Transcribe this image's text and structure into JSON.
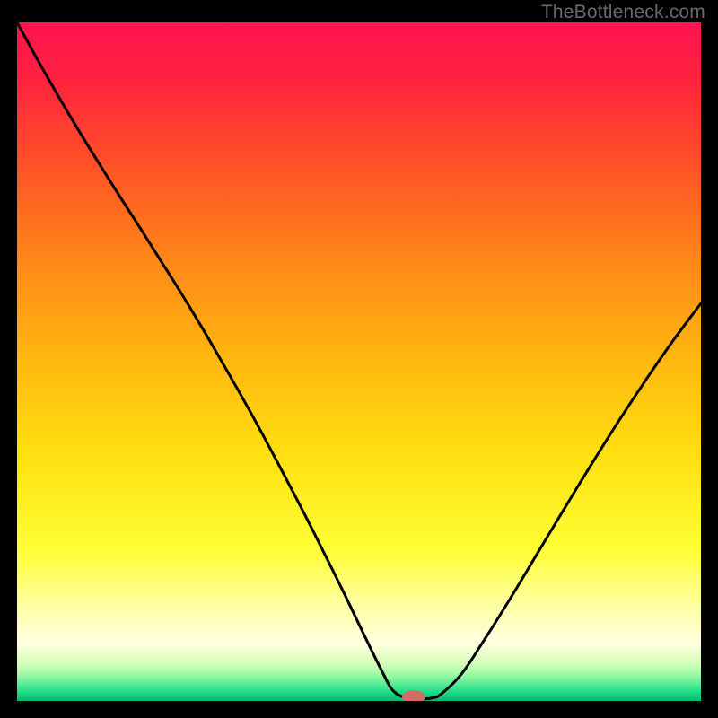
{
  "watermark": "TheBottleneck.com",
  "colors": {
    "background": "#000000",
    "gradient_stops": [
      {
        "offset": 0.0,
        "color": "#ff1450"
      },
      {
        "offset": 0.08,
        "color": "#ff213f"
      },
      {
        "offset": 0.2,
        "color": "#ff4e28"
      },
      {
        "offset": 0.35,
        "color": "#ff8718"
      },
      {
        "offset": 0.5,
        "color": "#ffb80f"
      },
      {
        "offset": 0.64,
        "color": "#ffe010"
      },
      {
        "offset": 0.78,
        "color": "#ffff36"
      },
      {
        "offset": 0.86,
        "color": "#ffffa4"
      },
      {
        "offset": 0.915,
        "color": "#ffffe0"
      },
      {
        "offset": 0.945,
        "color": "#d6ffb8"
      },
      {
        "offset": 0.965,
        "color": "#8bf7a0"
      },
      {
        "offset": 0.985,
        "color": "#25e08a"
      },
      {
        "offset": 1.0,
        "color": "#05b770"
      }
    ],
    "curve": "#000000",
    "marker_fill": "#d66a67",
    "marker_stroke": "#d66a67"
  },
  "chart_data": {
    "type": "line",
    "title": "",
    "xlabel": "",
    "ylabel": "",
    "xlim": [
      0,
      100
    ],
    "ylim": [
      0,
      100
    ],
    "x": [
      0,
      3,
      6,
      9,
      12,
      15,
      18,
      21,
      24,
      27,
      30,
      33,
      36,
      39,
      42,
      45,
      48,
      51,
      53.5,
      55,
      57,
      59,
      60.5,
      62,
      65,
      68,
      72,
      76,
      80,
      84,
      88,
      92,
      96,
      100
    ],
    "values": [
      100,
      94.5,
      89.2,
      84.1,
      79.2,
      74.4,
      69.7,
      64.9,
      60.1,
      55.1,
      49.9,
      44.6,
      39.1,
      33.4,
      27.6,
      21.6,
      15.5,
      9.2,
      4.1,
      1.5,
      0.4,
      0.3,
      0.4,
      1.0,
      4.0,
      8.5,
      14.9,
      21.6,
      28.3,
      34.9,
      41.3,
      47.4,
      53.2,
      58.6
    ],
    "marker": {
      "x": 58.0,
      "y": 0.6,
      "rx": 1.7,
      "ry": 0.95
    },
    "notes": "x and y are percentages of the plot area width/height; y is measured from the bottom (0) to the top (100). Curve shows a bottleneck-style V dipping to ~0 near x≈58."
  }
}
